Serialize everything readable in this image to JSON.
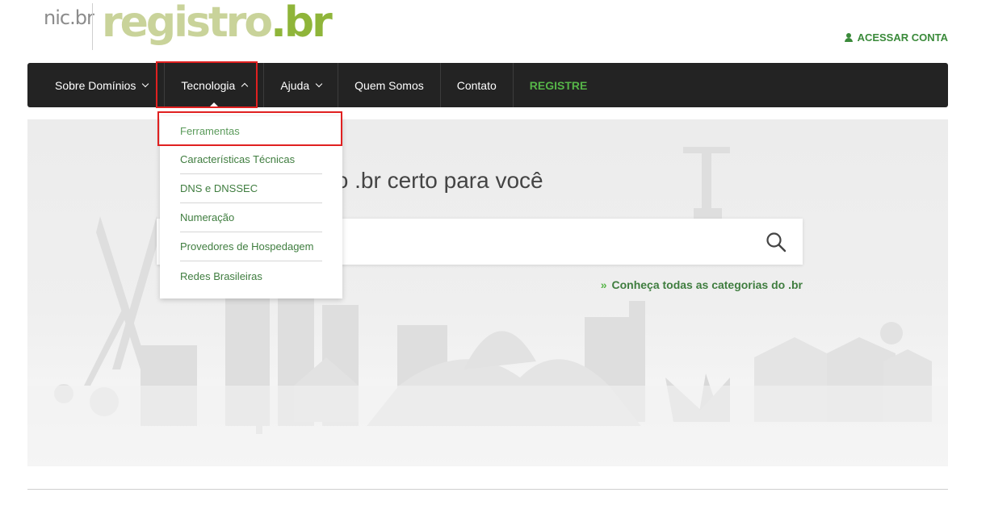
{
  "header": {
    "logo_nic": "nic.br",
    "logo_registro": "registro",
    "logo_registro_suffix": ".br",
    "account_icon": "user-icon",
    "account_label": "ACESSAR CONTA"
  },
  "nav": {
    "items": [
      {
        "label": "Sobre Domínios",
        "has_dropdown": true
      },
      {
        "label": "Tecnologia",
        "has_dropdown": true,
        "expanded": true
      },
      {
        "label": "Ajuda",
        "has_dropdown": true
      },
      {
        "label": "Quem Somos"
      },
      {
        "label": "Contato"
      },
      {
        "label": "REGISTRE"
      }
    ]
  },
  "dropdown": {
    "items": [
      {
        "label": "Ferramentas"
      },
      {
        "label": "Características Técnicas"
      },
      {
        "label": "DNS e DNSSEC"
      },
      {
        "label": "Numeração"
      },
      {
        "label": "Provedores de Hospedagem"
      },
      {
        "label": "Redes Brasileiras"
      }
    ]
  },
  "hero": {
    "title_visible": "nio .br certo para você",
    "search_placeholder": "",
    "search_icon": "search-icon",
    "categories_prefix": "»",
    "categories_link": "Conheça todas as categorias do .br"
  },
  "colors": {
    "nav_bg": "#232323",
    "accent_green": "#56b548",
    "link_green": "#3f7d3f",
    "highlight_red": "#e02020"
  }
}
